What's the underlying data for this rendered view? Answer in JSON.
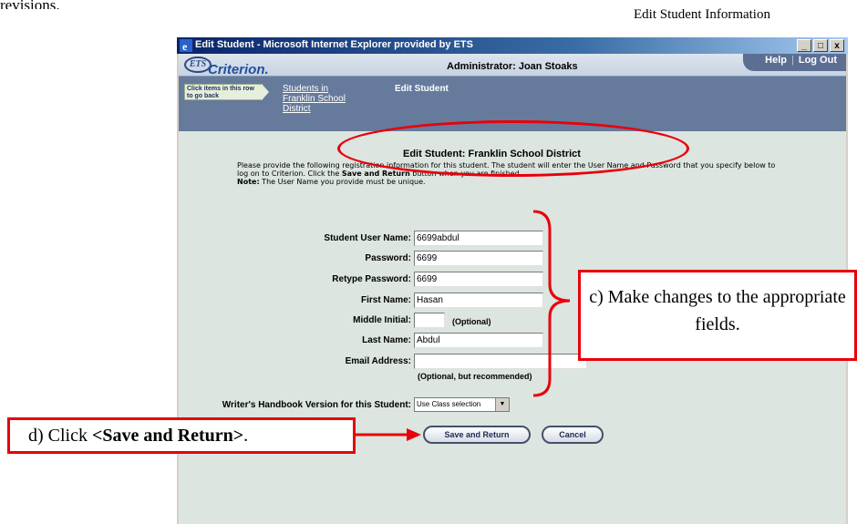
{
  "doc": {
    "top_text": "revisions.",
    "header": "Edit Student Information"
  },
  "window": {
    "title": "Edit Student - Microsoft Internet Explorer provided by ETS",
    "controls": [
      "_",
      "□",
      "x"
    ]
  },
  "app": {
    "logo_mark": "ETS",
    "logo_word": "Criterion.",
    "admin_label": "Administrator: Joan Stoaks",
    "help_link": "Help",
    "logout_link": "Log Out",
    "nav_hint": "Click items in this row to go back",
    "breadcrumb_link": "Students in Franklin School District",
    "breadcrumb_current": "Edit Student"
  },
  "page": {
    "title": "Edit Student:  Franklin School District",
    "instructions_1": "Please provide the following registration information for this student. The student will enter the User Name and Password that you specify below to log on to Criterion. Click the ",
    "instructions_bold": "Save and Return",
    "instructions_2": " button when you are finished.",
    "note_label": "Note:",
    "note_text": " The User Name you provide must be unique."
  },
  "form": {
    "username_label": "Student User Name:",
    "username_value": "6699abdul",
    "password_label": "Password:",
    "password_value": "6699",
    "retype_label": "Retype Password:",
    "retype_value": "6699",
    "first_label": "First Name:",
    "first_value": "Hasan",
    "middle_label": "Middle Initial:",
    "middle_value": "",
    "middle_optional": "(Optional)",
    "last_label": "Last Name:",
    "last_value": "Abdul",
    "email_label": "Email Address:",
    "email_value": "",
    "email_optional": "(Optional, but recommended)",
    "handbook_label": "Writer's Handbook Version for this Student:",
    "handbook_value": "Use Class selection",
    "save_button": "Save and Return",
    "cancel_button": "Cancel"
  },
  "annotations": {
    "callout_c": "c) Make changes to the appropriate fields.",
    "callout_d_prefix": "d) Click ",
    "callout_d_bold": "<Save and Return>",
    "callout_d_suffix": ".",
    "color": "#e8000b"
  }
}
